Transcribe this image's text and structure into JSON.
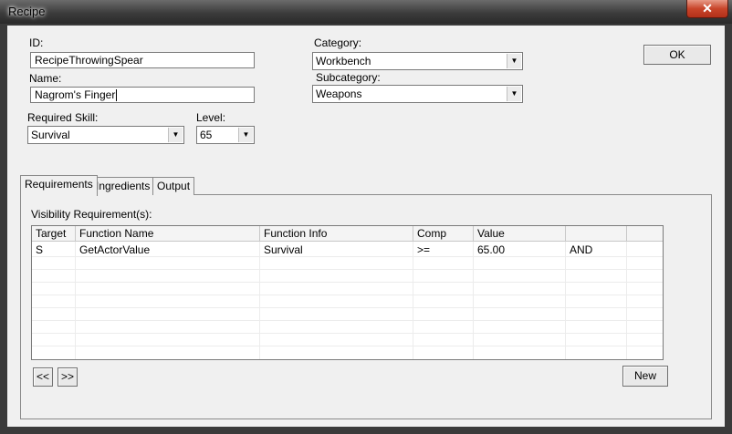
{
  "window": {
    "title": "Recipe",
    "close_label": "✕"
  },
  "form": {
    "id_label": "ID:",
    "id_value": "RecipeThrowingSpear",
    "name_label": "Name:",
    "name_value": "Nagrom's Finger",
    "category_label": "Category:",
    "category_value": "Workbench",
    "subcategory_label": "Subcategory:",
    "subcategory_value": "Weapons",
    "skill_label": "Required Skill:",
    "skill_value": "Survival",
    "level_label": "Level:",
    "level_value": "65",
    "ok_label": "OK"
  },
  "tabs": [
    {
      "label": "Requirements",
      "active": true
    },
    {
      "label": "Ingredients",
      "active": false
    },
    {
      "label": "Output",
      "active": false
    }
  ],
  "requirements": {
    "label": "Visibility Requirement(s):",
    "columns": [
      "Target",
      "Function Name",
      "Function Info",
      "Comp",
      "Value",
      ""
    ],
    "rows": [
      [
        "S",
        "GetActorValue",
        "Survival",
        ">=",
        "65.00",
        "AND"
      ]
    ],
    "prev_label": "<<",
    "next_label": ">>",
    "new_label": "New"
  }
}
